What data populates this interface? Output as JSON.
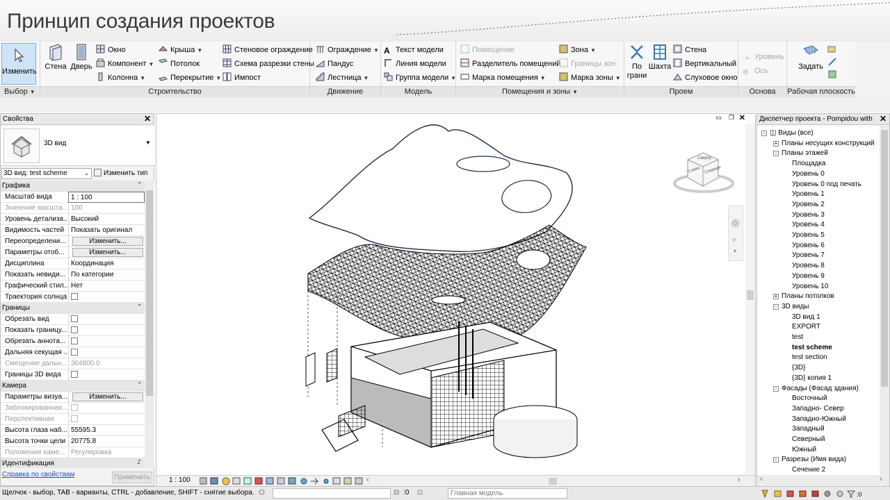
{
  "slide_title": "Принцип создания проектов",
  "ribbon": {
    "select": {
      "button": "Изменить",
      "label": "Выбор"
    },
    "build": {
      "label": "Строительство",
      "wall": "Стена",
      "door": "Дверь",
      "window": "Окно",
      "component": "Компонент",
      "column": "Колонна",
      "roof": "Крыша",
      "ceiling": "Потолок",
      "floor": "Перекрытие",
      "curtain_system": "Стеновое ограждение",
      "curtain_grid": "Схема разрезки стены",
      "mullion": "Импост"
    },
    "circulation": {
      "label": "Движение",
      "railing": "Ограждение",
      "ramp": "Пандус",
      "stair": "Лестница"
    },
    "model": {
      "label": "Модель",
      "model_text": "Текст модели",
      "model_line": "Линия модели",
      "model_group": "Группа модели"
    },
    "room": {
      "label": "Помещения и зоны",
      "room": "Помещение",
      "room_separator": "Разделитель помещений",
      "room_tag": "Марка помещения",
      "area": "Зона",
      "area_boundary": "Границы зон",
      "area_tag": "Марка зоны"
    },
    "opening": {
      "label": "Проем",
      "by_face": "По грани",
      "by_face_l1": "По",
      "by_face_l2": "грани",
      "shaft": "Шахта",
      "wall": "Стена",
      "vertical": "Вертикальный",
      "dormer": "Слуховое окно"
    },
    "datum": {
      "label": "Основа",
      "level": "Уровень",
      "grid": "Ось"
    },
    "workplane": {
      "label": "Рабочая плоскость",
      "set": "Задать"
    }
  },
  "properties": {
    "title": "Свойства",
    "type_name": "3D вид",
    "view_selector": "3D вид: test scheme",
    "edit_type": "Изменить тип",
    "rows": [
      {
        "kind": "group",
        "k": "Графика"
      },
      {
        "k": "Масштаб вида",
        "v": "1 : 100",
        "input": true
      },
      {
        "k": "Значение масшта...",
        "v": "100",
        "dis": true
      },
      {
        "k": "Уровень детализа...",
        "v": "Высокий"
      },
      {
        "k": "Видимость частей",
        "v": "Показать оригинал"
      },
      {
        "k": "Переопределени...",
        "btn": "Изменить..."
      },
      {
        "k": "Параметры отоб...",
        "btn": "Изменить..."
      },
      {
        "k": "Дисциплина",
        "v": "Координация"
      },
      {
        "k": "Показать невиди...",
        "v": "По категории"
      },
      {
        "k": "Графический стил...",
        "v": "Нет"
      },
      {
        "k": "Траектория солнца",
        "chk": true
      },
      {
        "kind": "group",
        "k": "Границы"
      },
      {
        "k": "Обрезать вид",
        "chk": true
      },
      {
        "k": "Показать границу...",
        "chk": true
      },
      {
        "k": "Обрезать аннота...",
        "chk": true
      },
      {
        "k": "Дальняя секущая ...",
        "chk": true
      },
      {
        "k": "Смещение дальн...",
        "v": "304800.0",
        "dis": true
      },
      {
        "k": "Границы 3D вида",
        "chk": true
      },
      {
        "kind": "group",
        "k": "Камера"
      },
      {
        "k": "Параметры визуа...",
        "btn": "Изменить..."
      },
      {
        "k": "Заблокированная...",
        "chk": true,
        "dis": true
      },
      {
        "k": "Перспективная",
        "chk": true,
        "dis": true
      },
      {
        "k": "Высота глаза наб...",
        "v": "55595.3"
      },
      {
        "k": "Высота точки цели",
        "v": "20775.8"
      },
      {
        "k": "Положение каме...",
        "v": "Регулировка",
        "dis": true
      },
      {
        "kind": "group",
        "k": "Идентификация"
      }
    ],
    "help_link": "Справка по свойствам",
    "apply": "Применить"
  },
  "viewport": {
    "scale": "1 : 100",
    "viewcube": {
      "front": "Спереди",
      "side": "Слева",
      "top": "Сверху"
    }
  },
  "browser": {
    "title": "Диспетчер проекта - Pompidou with stu...",
    "nodes": [
      {
        "t": "Виды (все)",
        "lvl": 0,
        "tog": "-",
        "root": true
      },
      {
        "t": "Планы несущих конструкций",
        "lvl": 1,
        "tog": "+"
      },
      {
        "t": "Планы этажей",
        "lvl": 1,
        "tog": "-"
      },
      {
        "t": "Площадка",
        "lvl": 2
      },
      {
        "t": "Уровень 0",
        "lvl": 2
      },
      {
        "t": "Уровень 0 под печать",
        "lvl": 2
      },
      {
        "t": "Уровень 1",
        "lvl": 2
      },
      {
        "t": "Уровень 2",
        "lvl": 2
      },
      {
        "t": "Уровень 3",
        "lvl": 2
      },
      {
        "t": "Уровень 4",
        "lvl": 2
      },
      {
        "t": "Уровень 5",
        "lvl": 2
      },
      {
        "t": "Уровень 6",
        "lvl": 2
      },
      {
        "t": "Уровень 7",
        "lvl": 2
      },
      {
        "t": "Уровень 8",
        "lvl": 2
      },
      {
        "t": "Уровень 9",
        "lvl": 2
      },
      {
        "t": "Уровень 10",
        "lvl": 2
      },
      {
        "t": "Планы потолков",
        "lvl": 1,
        "tog": "+"
      },
      {
        "t": "3D виды",
        "lvl": 1,
        "tog": "-"
      },
      {
        "t": "3D вид 1",
        "lvl": 2
      },
      {
        "t": "EXPORT",
        "lvl": 2
      },
      {
        "t": "test",
        "lvl": 2
      },
      {
        "t": "test scheme",
        "lvl": 2,
        "bold": true
      },
      {
        "t": "test section",
        "lvl": 2
      },
      {
        "t": "{3D}",
        "lvl": 2
      },
      {
        "t": "{3D} копия 1",
        "lvl": 2
      },
      {
        "t": "Фасады (Фасад здания)",
        "lvl": 1,
        "tog": "-"
      },
      {
        "t": "Восточный",
        "lvl": 2
      },
      {
        "t": "Западно- Север",
        "lvl": 2
      },
      {
        "t": "Западно-Южный",
        "lvl": 2
      },
      {
        "t": "Западный",
        "lvl": 2
      },
      {
        "t": "Северный",
        "lvl": 2
      },
      {
        "t": "Южный",
        "lvl": 2
      },
      {
        "t": "Разрезы (Имя вида)",
        "lvl": 1,
        "tog": "-"
      },
      {
        "t": "Сечение 2",
        "lvl": 2
      }
    ]
  },
  "status": {
    "hint": "Щелчок - выбор, TAB - варианты, CTRL - добавление, SHIFT - снятие выбора.",
    "count": ":0",
    "model": "Главная модель"
  }
}
